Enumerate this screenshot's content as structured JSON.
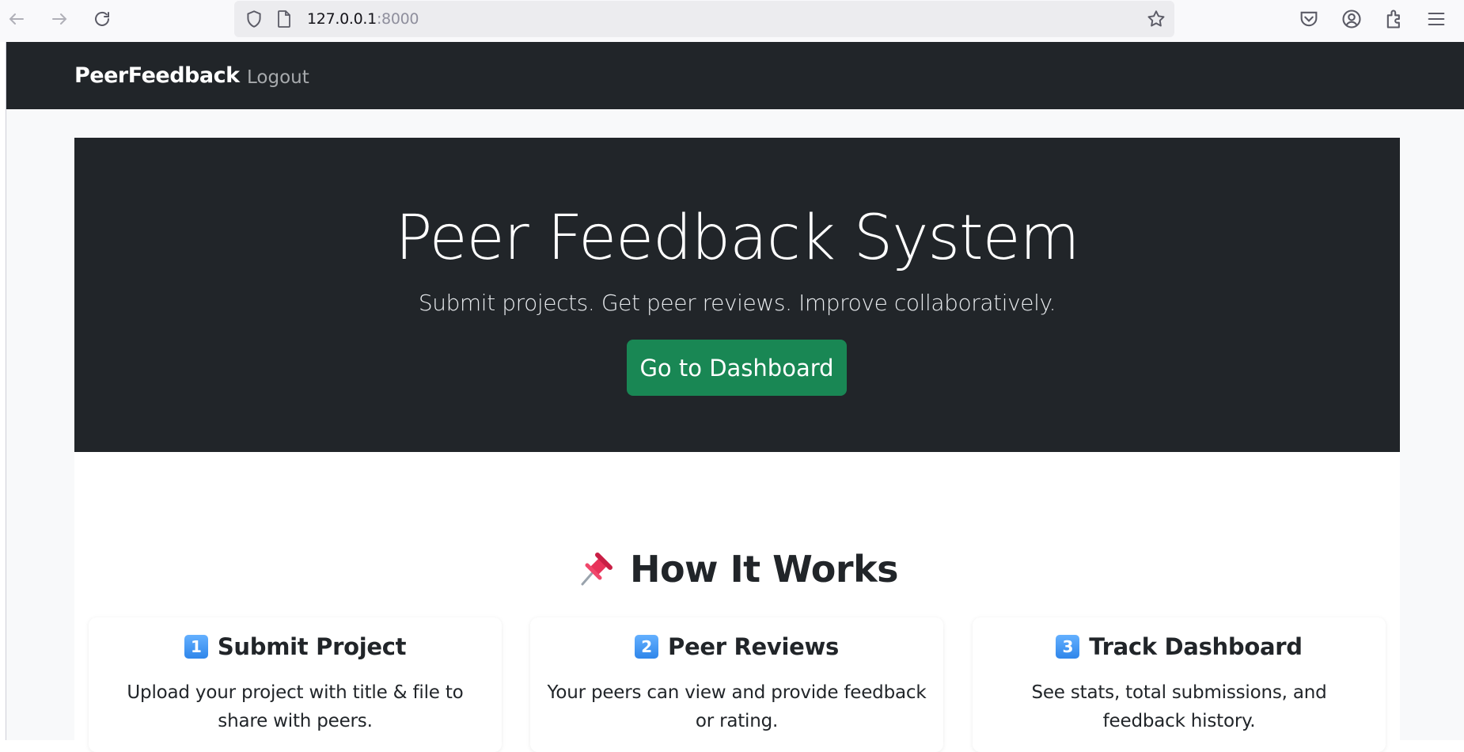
{
  "browser": {
    "url_host": "127.0.0.1",
    "url_port": ":8000"
  },
  "navbar": {
    "brand": "PeerFeedback",
    "logout": "Logout"
  },
  "hero": {
    "title": "Peer Feedback System",
    "subtitle": "Submit projects. Get peer reviews. Improve collaboratively.",
    "cta": "Go to Dashboard"
  },
  "how_it_works": {
    "icon": "pushpin-icon",
    "title": "How It Works",
    "steps": [
      {
        "number": "1",
        "title": "Submit Project",
        "description": "Upload your project with title & file to share with peers."
      },
      {
        "number": "2",
        "title": "Peer Reviews",
        "description": "Your peers can view and provide feedback or rating."
      },
      {
        "number": "3",
        "title": "Track Dashboard",
        "description": "See stats, total submissions, and feedback history."
      }
    ]
  },
  "colors": {
    "dark": "#212529",
    "success": "#198754",
    "light_bg": "#f8f9fa"
  }
}
